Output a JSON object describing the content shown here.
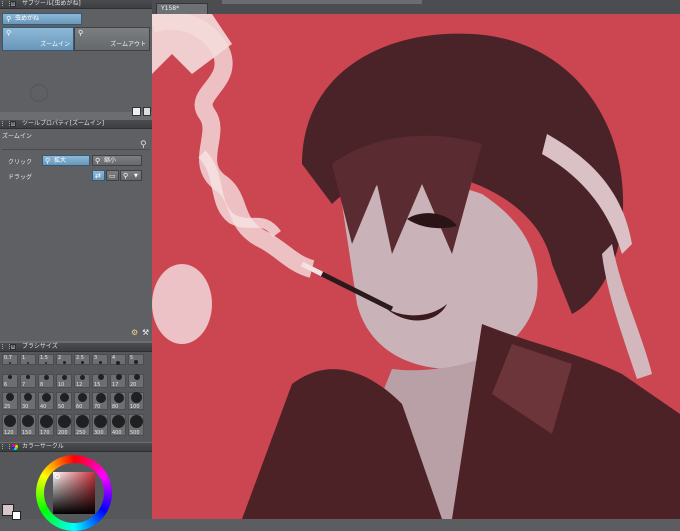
{
  "subtool_panel": {
    "title": "サブツール[虫めがね]",
    "items": [
      {
        "label": "虫めがね"
      },
      {
        "label": "ズームイン"
      },
      {
        "label": "ズームアウト"
      }
    ]
  },
  "tool_property": {
    "title": "ツールプロパティ[ズームイン]",
    "header": "ズームイン",
    "click_label": "クリック",
    "zoom_in": "拡大",
    "zoom_out": "縮小",
    "drag_label": "ドラッグ"
  },
  "brush_size": {
    "title": "ブラシサイズ",
    "row1": [
      "0.7",
      "1",
      "1.5",
      "2",
      "2.5",
      "3",
      "4",
      "5"
    ],
    "row2": [
      "6",
      "7",
      "8",
      "10",
      "12",
      "15",
      "17",
      "20"
    ],
    "row3": [
      "25",
      "30",
      "40",
      "50",
      "60",
      "70",
      "80",
      "100"
    ],
    "row4": [
      "120",
      "150",
      "170",
      "200",
      "250",
      "300",
      "400",
      "500"
    ]
  },
  "color_panel": {
    "title": "カラーサークル"
  },
  "canvas": {
    "tab_label": "Y158*"
  },
  "colors": {
    "canvas_bg": "#cc4651",
    "accent": "#7ea8c9"
  }
}
